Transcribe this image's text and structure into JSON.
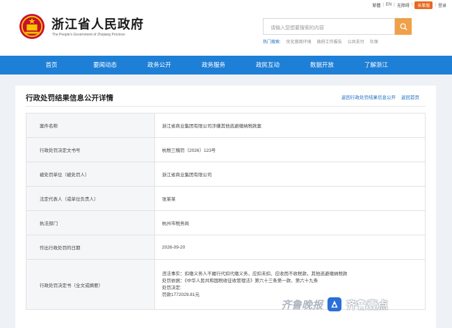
{
  "topbar": {
    "items": [
      "繁體",
      "EN",
      "无障碍",
      "长辈版",
      "登录"
    ]
  },
  "header": {
    "title": "浙江省人民政府",
    "subtitle": "The People's Government of Zhejiang Province",
    "search_placeholder": "请输入您想要搜索的内容",
    "hot_label": "热门搜索:",
    "hot_items": [
      "优化营商环境",
      "政府工作报告",
      "公共支付",
      "社保"
    ]
  },
  "nav": {
    "items": [
      "首页",
      "要闻动态",
      "政务公开",
      "政务服务",
      "政民互动",
      "数据开放",
      "了解浙江"
    ]
  },
  "card": {
    "title": "行政处罚结果信息公开详情",
    "links": [
      "返回行政处罚结果信息公开",
      "返回首页"
    ],
    "rows": [
      {
        "key": "案件名称",
        "value": "浙江省商业集团有限公司涉嫌其他逃避缴纳税款案"
      },
      {
        "key": "行政处罚决定文书号",
        "value": "杭税三稽罚〔2026〕123号"
      },
      {
        "key": "被处罚单位（被处罚人）",
        "value": "浙江省商业集团有限公司"
      },
      {
        "key": "法定代表人（或单位负责人）",
        "value": "张某某"
      },
      {
        "key": "执法部门",
        "value": "杭州市税务局"
      },
      {
        "key": "作出行政处罚的日期",
        "value": "2026-09-20"
      }
    ],
    "decision": {
      "key": "行政处罚决定书（全文或摘要）",
      "lines": [
        "违法事实：扣缴义务人不履行代扣代缴义务，应扣未扣、应收而不收税款，其他逃避缴纳税款",
        "处罚依据：《中华人民共和国税收征收管理法》第六十三条第一款、第六十九条",
        "处罚决定:",
        "罚款1772029.81元"
      ]
    }
  },
  "watermark": {
    "left": "齐鲁晚报",
    "right": "齐鲁壹点"
  },
  "colors": {
    "nav_bg": "#1e7fd6",
    "accent_orange": "#f0a048",
    "link_blue": "#1c6fc2"
  }
}
